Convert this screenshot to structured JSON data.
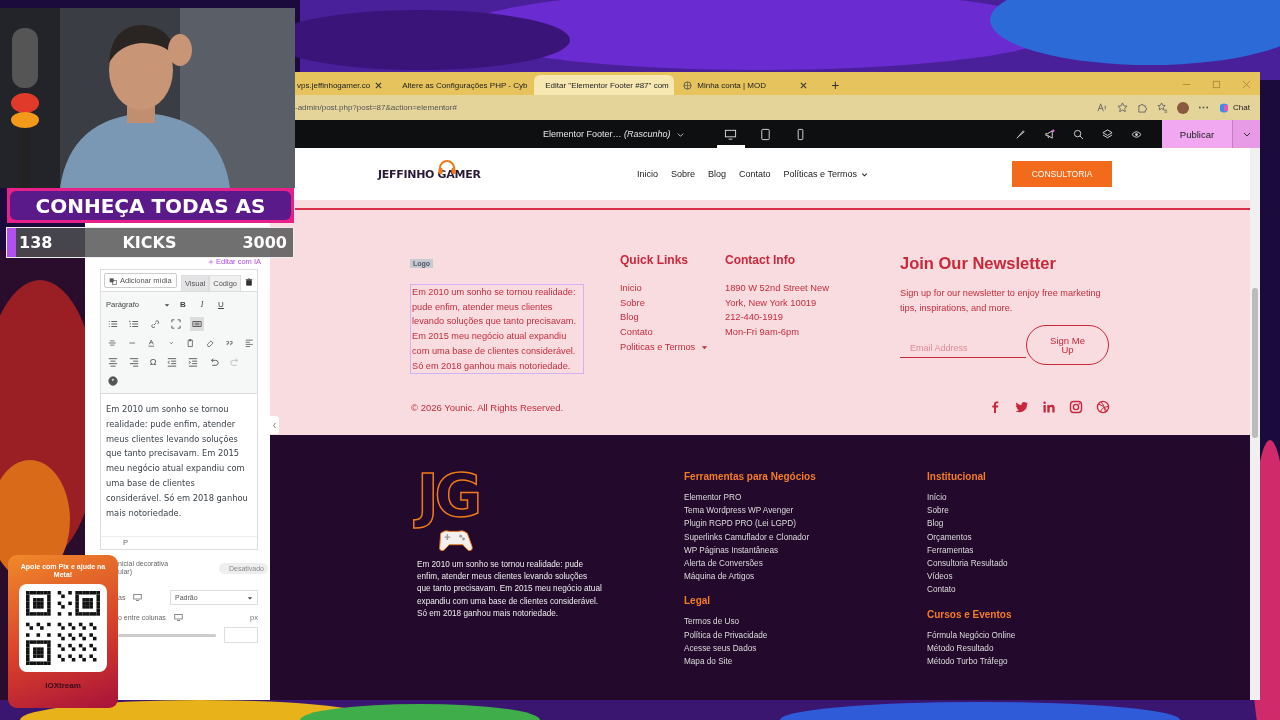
{
  "stream_overlay": {
    "banner": "CONHEÇA TODAS AS",
    "goal": {
      "current": "138",
      "label": "KICKS",
      "target": "3000",
      "level": 0.03
    },
    "donation": {
      "title": "Apoie com Pix e ajude na Meta!",
      "brand": "**IOX**tream"
    }
  },
  "browser": {
    "tabs": [
      {
        "label": "vps.jeffinhogamer.co",
        "selected": false
      },
      {
        "label": "Altere as Configurações PHP - Cyb",
        "selected": false
      },
      {
        "label": "Editar \"Elementor Footer #87\" com",
        "selected": true
      },
      {
        "label": "Minha conta | MOD",
        "selected": false
      }
    ],
    "new_tab": "+",
    "url": "-admin/post.php?post=87&action=elementor#",
    "chat": "Chat"
  },
  "editor_bar": {
    "title": "Elementor Footer… *(Rascunho)*",
    "devices": [
      {
        "kind": "desktop",
        "selected": true
      },
      {
        "kind": "tablet",
        "selected": false
      },
      {
        "kind": "mobile",
        "selected": false
      }
    ],
    "publish": "Publicar"
  },
  "panel": {
    "ai_link": "Editar com IA",
    "add_media": "Adicionar mídia",
    "editor_tabs": [
      {
        "label": "Visual",
        "selected": true
      },
      {
        "label": "Código",
        "selected": false
      }
    ],
    "format": "Parágrafo",
    "format_buttons": [
      "B",
      "I",
      "U"
    ],
    "special_char": "Ω",
    "content": "Em 2010 um sonho se tornou realidade: pude enfim, atender meus clientes levando soluções que tanto precisavam. Em 2015 meu negócio atual expandiu com uma base de clientes considerável. Só em 2018 ganhou mais notoriedade.",
    "path": "P",
    "drop_cap": {
      "label": [
        "nicial decorativa",
        "ular)"
      ],
      "toggle_label": "Desativado",
      "on": false
    },
    "columns": {
      "label": "as",
      "value": "Padrão"
    },
    "gap": {
      "label": "o entre colunas",
      "unit": "px",
      "level": 1
    }
  },
  "site_header": {
    "logo": "JEFFINHO GAMER",
    "nav": [
      {
        "label": "Inicio",
        "has_submenu": false
      },
      {
        "label": "Sobre",
        "has_submenu": false
      },
      {
        "label": "Blog",
        "has_submenu": false
      },
      {
        "label": "Contato",
        "has_submenu": false
      },
      {
        "label": "Políticas e Termos",
        "has_submenu": true
      }
    ],
    "cta": "CONSULTORIA"
  },
  "footer_light": {
    "logo_tag": "Logo",
    "about": "Em 2010 um sonho se tornou realidade: pude enfim, atender meus clientes levando soluções que tanto precisavam. Em 2015 meu negócio atual expandiu com uma base de clientes considerável. Só em 2018 ganhou mais notoriedade.",
    "quick_links": {
      "title": "Quick Links",
      "items": [
        {
          "label": "Inicio",
          "has_submenu": false
        },
        {
          "label": "Sobre",
          "has_submenu": false
        },
        {
          "label": "Blog",
          "has_submenu": false
        },
        {
          "label": "Contato",
          "has_submenu": false
        },
        {
          "label": "Politicas e Termos",
          "has_submenu": true
        }
      ]
    },
    "contact": {
      "title": "Contact Info",
      "lines": [
        "1890 W 52nd Street New York, New York 10019",
        "212-440-1919",
        "Mon-Fri 9am-6pm"
      ]
    },
    "newsletter": {
      "title": "Join Our Newsletter",
      "text": "Sign up for our newsletter to enjoy free marketing tips, inspirations, and more.",
      "placeholder": "Email Address",
      "button": "Sign Me Up"
    },
    "copyright": "© 2026 Younic. All Rights Reserved."
  },
  "footer_dark": {
    "logo": "JG",
    "about": "Em 2010 um sonho se tornou realidade: pude enfim, atender meus clientes levando soluções que tanto precisavam. Em 2015 meu negócio atual expandiu com uma base de clientes considerável. Só em 2018 ganhou mais notoriedade.",
    "columns": [
      {
        "groups": [
          {
            "title": "Ferramentas para Negócios",
            "items": [
              "Elementor PRO",
              "Tema Wordpress WP Avenger",
              "Plugin RGPD PRO (Lei LGPD)",
              "Superlinks Camuflador e Clonador",
              "WP Páginas Instantâneas",
              "Alerta de Conversões",
              "Máquina de Artigos"
            ]
          },
          {
            "title": "Legal",
            "items": [
              "Termos de Uso",
              "Política de Privacidade",
              "Acesse seus Dados",
              "Mapa do Site"
            ]
          }
        ]
      },
      {
        "groups": [
          {
            "title": "Institucional",
            "items": [
              "Início",
              "Sobre",
              "Blog",
              "Orçamentos",
              "Ferramentas",
              "Consultoria Resultado",
              "Vídeos",
              "Contato"
            ]
          },
          {
            "title": "Cursos e Eventos",
            "items": [
              "Fórmula Negócio Online",
              "Método Resultado",
              "Método Turbo Tráfego"
            ]
          }
        ]
      }
    ]
  }
}
